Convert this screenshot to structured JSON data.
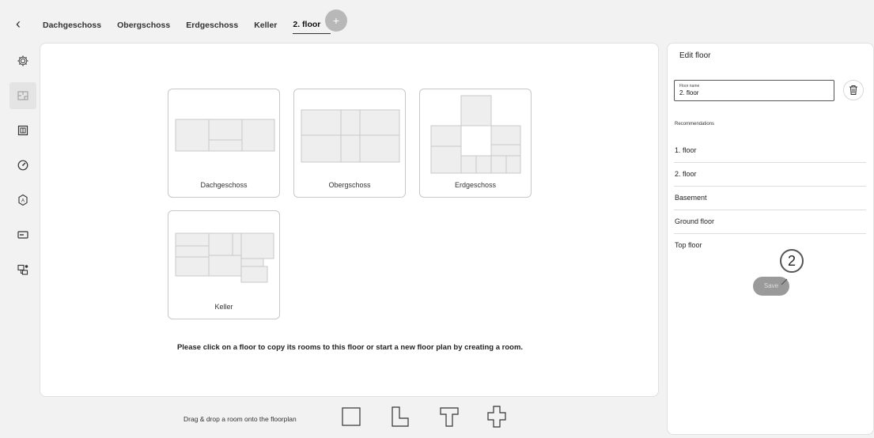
{
  "header": {
    "back_icon": "chevron-left-icon",
    "tabs": [
      {
        "label": "Dachgeschoss"
      },
      {
        "label": "Obergschoss"
      },
      {
        "label": "Erdgeschoss"
      },
      {
        "label": "Keller"
      },
      {
        "label": "2. floor",
        "active": true
      }
    ],
    "drag_handle": "⠿",
    "add_label": "+"
  },
  "sidebar": {
    "items": [
      {
        "icon": "gear-icon"
      },
      {
        "icon": "floorplan-icon",
        "selected": true
      },
      {
        "icon": "window-icon"
      },
      {
        "icon": "gauge-icon"
      },
      {
        "icon": "shield-icon"
      },
      {
        "icon": "card-icon"
      },
      {
        "icon": "devices-icon"
      }
    ]
  },
  "main": {
    "floors": [
      {
        "label": "Dachgeschoss"
      },
      {
        "label": "Obergschoss"
      },
      {
        "label": "Erdgeschoss"
      },
      {
        "label": "Keller"
      }
    ],
    "hint": "Please click on a floor to copy its rooms to this floor or start a new floor plan by creating a room."
  },
  "bottom": {
    "drag_text": "Drag & drop a room onto the floorplan",
    "shapes": [
      "square-room-icon",
      "l-room-icon",
      "t-room-icon",
      "cross-room-icon"
    ]
  },
  "edit_panel": {
    "title": "Edit floor",
    "name_label": "Floor name",
    "name_value": "2. floor",
    "delete_icon": "trash-icon",
    "recommendations_title": "Recommendations",
    "recommendations": [
      "1. floor",
      "2. floor",
      "Basement",
      "Ground floor",
      "Top floor"
    ],
    "step_badge": "2",
    "save_label": "Save"
  },
  "colors": {
    "background": "#f2f2f2",
    "panel": "#ffffff",
    "room_fill": "#eeeeee",
    "room_stroke": "#c8c8c8",
    "save_button": "#9a9a9a",
    "add_button": "#b8b8b8"
  }
}
